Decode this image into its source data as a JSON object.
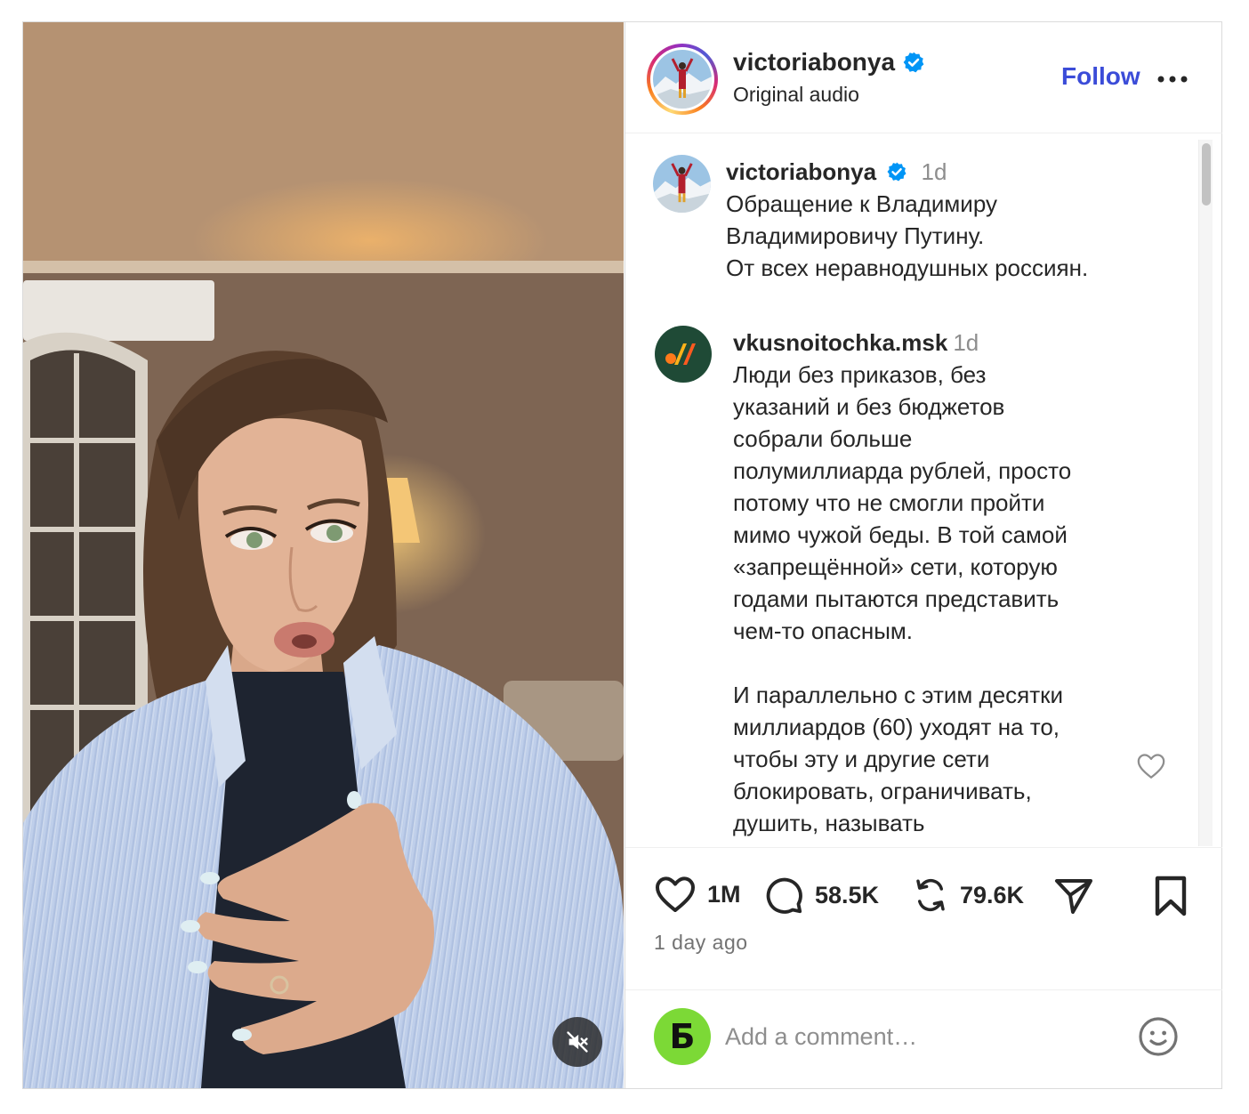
{
  "colors": {
    "link_blue": "#3b4cd8",
    "verified_blue": "#0095f6",
    "muted_text": "#8e8e8e",
    "dark_text": "#262626"
  },
  "media": {
    "mute_icon": "speaker-muted-icon"
  },
  "header": {
    "username": "victoriabonya",
    "subtitle": "Original audio",
    "follow_label": "Follow",
    "more_icon": "more-horizontal-icon"
  },
  "caption": {
    "username": "victoriabonya",
    "time": "1d",
    "lines": [
      "Обращение к Владимиру",
      "Владимировичу Путину.",
      "От всех неравнодушных россиян."
    ]
  },
  "comment": {
    "username": "vkusnoitochka.msk",
    "time": "1d",
    "lines": [
      "Люди без приказов, без",
      "указаний и без бюджетов",
      "собрали больше",
      "полумиллиарда рублей, просто",
      "потому что не смогли пройти",
      "мимо чужой беды. В той самой",
      "«запрещённой» сети, которую",
      "годами пытаются представить",
      "чем-то опасным."
    ],
    "lines2": [
      "И параллельно с этим десятки",
      "миллиардов (60) уходят на то,",
      "чтобы эту и другие сети",
      "блокировать, ограничивать,",
      "душить, называть"
    ],
    "like_icon": "heart-outline-icon"
  },
  "actions": {
    "likes": "1M",
    "comments": "58.5K",
    "reposts": "79.6K",
    "posted_ago": "1 day ago"
  },
  "add_comment": {
    "avatar_letter": "Б",
    "placeholder": "Add a comment…",
    "emoji_icon": "smiley-icon"
  }
}
